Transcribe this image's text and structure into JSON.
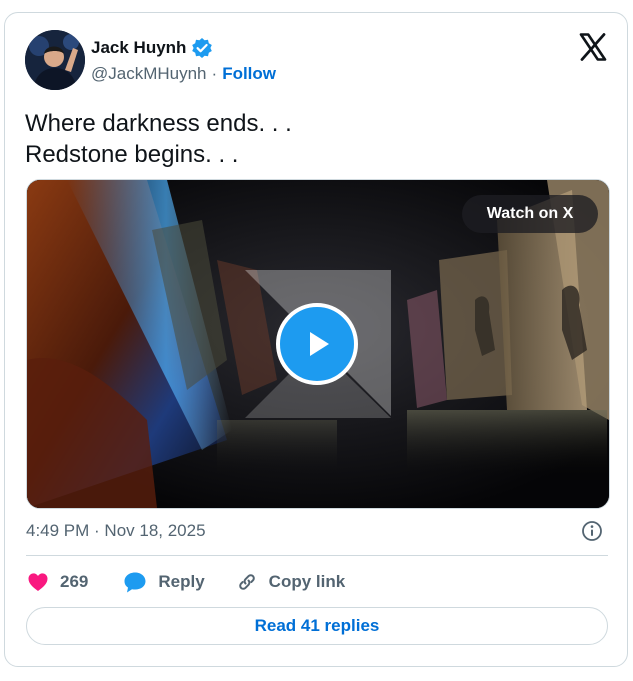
{
  "author": {
    "name": "Jack Huynh",
    "handle": "@JackMHuynh",
    "separator": "·",
    "follow_label": "Follow"
  },
  "tweet": {
    "lines": [
      "Where darkness ends. . .",
      "Redstone begins. . ."
    ],
    "timestamp": "4:49 PM · Nov 18, 2025"
  },
  "media": {
    "watch_label": "Watch on X"
  },
  "actions": {
    "like_count": "269",
    "reply_label": "Reply",
    "copy_label": "Copy link"
  },
  "read_replies_label": "Read 41 replies",
  "colors": {
    "accent": "#1d9bf0",
    "link": "#006fd6",
    "like": "#f91880",
    "border": "#cfd9de",
    "muted": "#536471"
  },
  "icons": {
    "verified": "verified-badge-icon",
    "platform": "x-logo-icon",
    "play": "play-icon",
    "info": "info-icon",
    "like": "heart-icon",
    "reply": "reply-bubble-icon",
    "copy": "link-icon"
  }
}
